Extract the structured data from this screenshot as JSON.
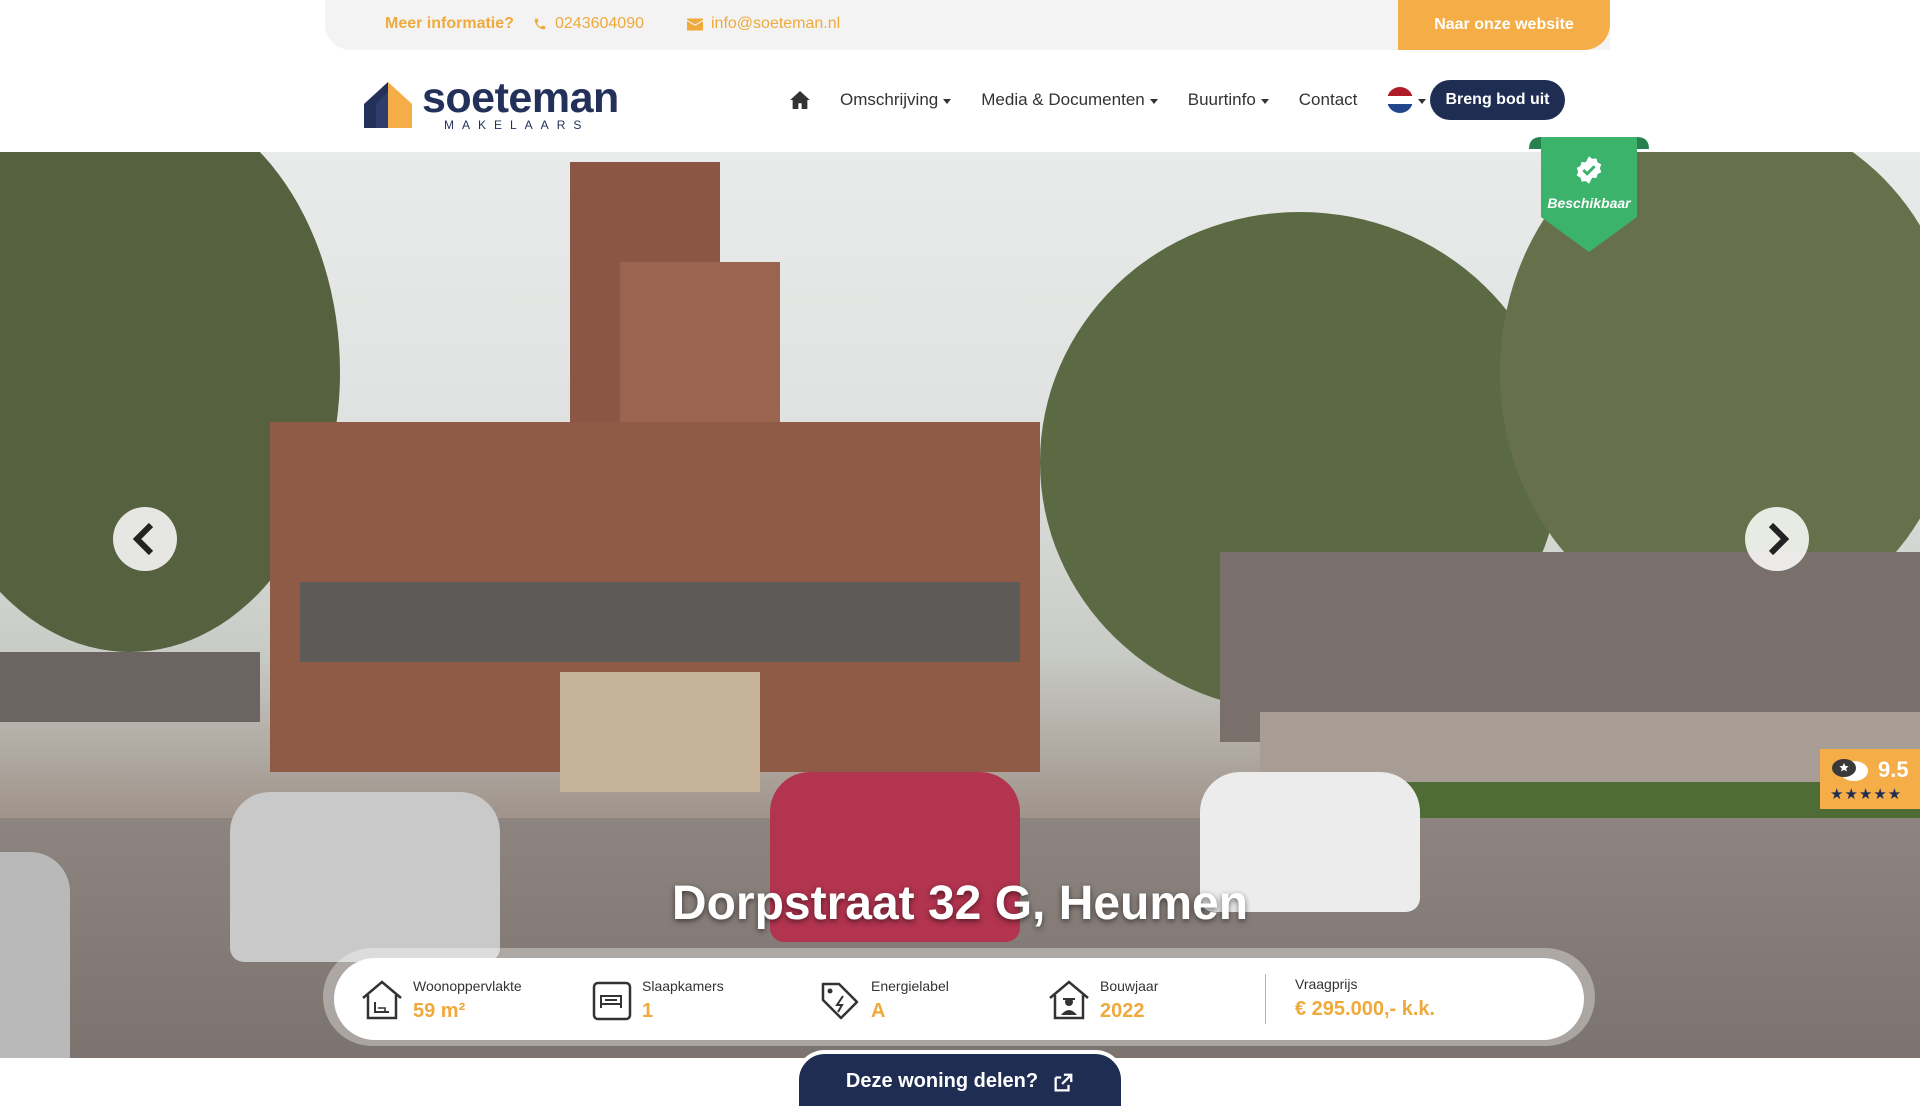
{
  "topbar": {
    "info_label": "Meer informatie?",
    "phone": "0243604090",
    "email": "info@soeteman.nl",
    "website_button": "Naar onze website"
  },
  "logo": {
    "name": "soeteman",
    "subtitle": "MAKELAARS"
  },
  "nav": {
    "home_icon": "home-icon",
    "items": [
      {
        "label": "Omschrijving"
      },
      {
        "label": "Media & Documenten"
      },
      {
        "label": "Buurtinfo"
      },
      {
        "label": "Contact"
      }
    ],
    "language": "nl-flag-icon",
    "bid_button": "Breng bod uit"
  },
  "hero": {
    "badge": "Beschikbaar",
    "title": "Dorpstraat 32 G, Heumen"
  },
  "stats": [
    {
      "icon": "house-area-icon",
      "label": "Woonoppervlakte",
      "value": "59 m²"
    },
    {
      "icon": "bed-icon",
      "label": "Slaapkamers",
      "value": "1"
    },
    {
      "icon": "energy-label-icon",
      "label": "Energielabel",
      "value": "A"
    },
    {
      "icon": "house-builder-icon",
      "label": "Bouwjaar",
      "value": "2022"
    }
  ],
  "price": {
    "label": "Vraagprijs",
    "value": "€ 295.000,- k.k."
  },
  "share_button": "Deze woning delen?",
  "rating": {
    "score": "9.5",
    "stars": "★★★★★"
  },
  "colors": {
    "accent": "#f5ae47",
    "navy": "#1f2d52",
    "badge_green": "#3cb36b"
  }
}
